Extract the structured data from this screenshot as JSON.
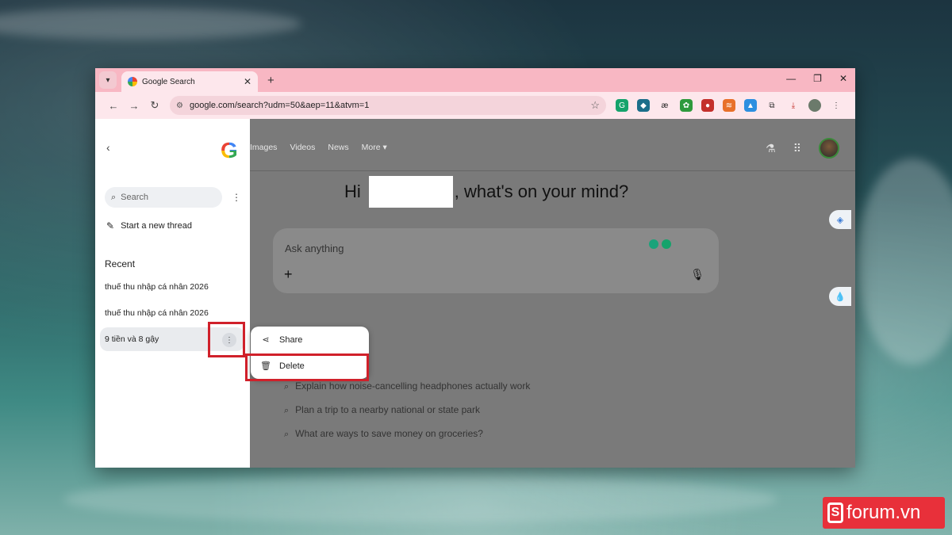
{
  "browser": {
    "tab_title": "Google Search",
    "tab_close": "✕",
    "new_tab": "+",
    "window_controls": [
      "—",
      "❐",
      "✕"
    ],
    "url": "google.com/search?udm=50&aep=11&atvm=1"
  },
  "sidebar": {
    "search_placeholder": "Search",
    "new_thread": "Start a new thread",
    "recent_title": "Recent",
    "recent_items": [
      {
        "label": "thuế thu nhập cá nhân 2026"
      },
      {
        "label": "thuế thu nhập cá nhân 2026"
      },
      {
        "label": "9 tiền và 8 gậy"
      }
    ]
  },
  "top_nav": {
    "links": [
      "Images",
      "Videos",
      "News",
      "More ▾"
    ]
  },
  "main": {
    "greeting_prefix": "Hi",
    "greeting_suffix": ", what's on your mind?",
    "ask_placeholder": "Ask anything",
    "suggestions": [
      "Explain how noise-cancelling headphones actually work",
      "Plan a trip to a nearby national or state park",
      "What are ways to save money on groceries?"
    ]
  },
  "context_menu": {
    "share": "Share",
    "delete": "Delete"
  },
  "watermark": {
    "text": "forum.vn"
  },
  "colors": {
    "tabbar": "#f8b7c3",
    "highlight": "#d0202a",
    "watermark": "#e8303a"
  }
}
